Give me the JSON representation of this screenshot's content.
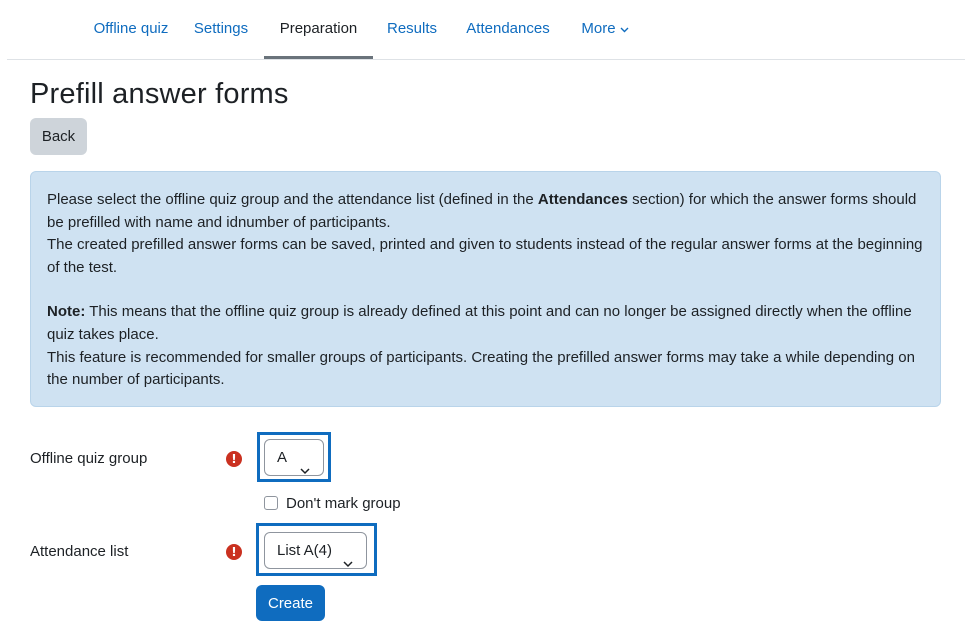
{
  "nav": {
    "tabs": [
      {
        "label": "Offline quiz"
      },
      {
        "label": "Settings"
      },
      {
        "label": "Preparation",
        "active": true
      },
      {
        "label": "Results"
      },
      {
        "label": "Attendances"
      },
      {
        "label": "More"
      }
    ]
  },
  "page": {
    "title": "Prefill answer forms",
    "back_label": "Back"
  },
  "info": {
    "p1_before": "Please select the offline quiz group and the attendance list (defined in the ",
    "p1_bold": "Attendances",
    "p1_after": " section) for which the answer forms should be prefilled with name and idnumber of participants.",
    "p2": "The created prefilled answer forms can be saved, printed and given to students instead of the regular answer forms at the beginning of the test.",
    "note_label": "Note:",
    "note_text": " This means that the offline quiz group is already defined at this point and can no longer be assigned directly when the offline quiz takes place.",
    "p4": "This feature is recommended for smaller groups of participants. Creating the prefilled answer forms may take a while depending on the number of participants."
  },
  "form": {
    "group_label": "Offline quiz group",
    "group_value": "A",
    "dont_mark_label": "Don't mark group",
    "dont_mark_checked": false,
    "attendance_label": "Attendance list",
    "attendance_value": "List A(4)",
    "required_symbol": "!",
    "create_label": "Create"
  },
  "colors": {
    "link": "#0f6cbf",
    "primary": "#0f6cbf",
    "required": "#ca3120",
    "info_bg": "#cfe2f2"
  },
  "icons": {
    "dropdown": "chevron-down-icon",
    "required": "exclamation-circle-icon"
  }
}
